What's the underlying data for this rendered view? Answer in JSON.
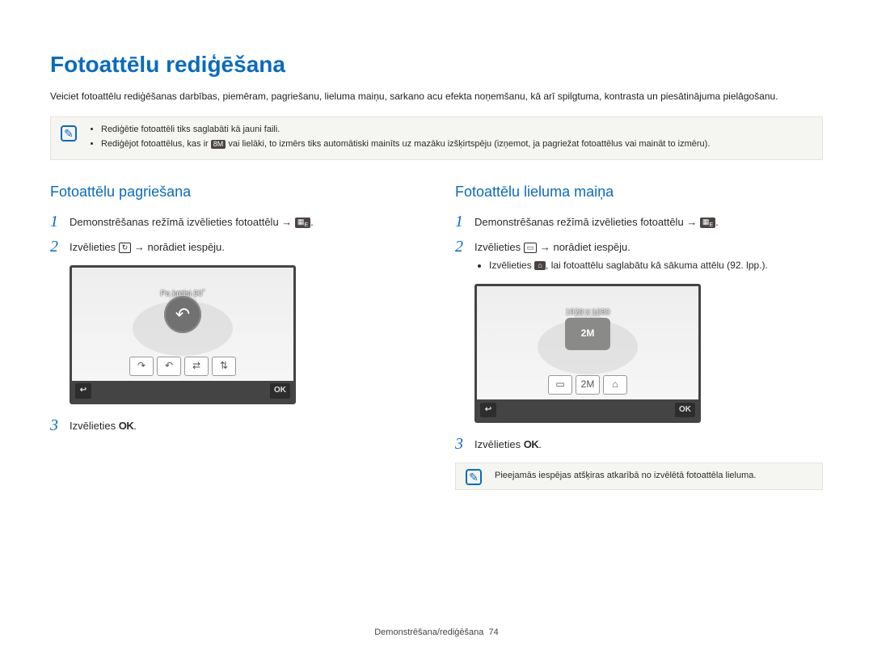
{
  "title": "Fotoattēlu rediģēšana",
  "intro": "Veiciet fotoattēlu rediģēšanas darbības, piemēram, pagriešanu, lieluma maiņu, sarkano acu efekta noņemšanu, kā arī spilgtuma, kontrasta un piesātinājuma pielāgošanu.",
  "note_top": {
    "item1": "Rediģētie fotoattēli tiks saglabāti kā jauni faili.",
    "item2_a": "Rediģējot fotoattēlus, kas ir ",
    "item2_icon": "8M",
    "item2_b": " vai lielāki, to izmērs tiks automātiski mainīts uz mazāku izšķirtspēju (izņemot, ja pagriežat fotoattēlus vai maināt to izmēru)."
  },
  "left": {
    "heading": "Fotoattēlu pagriešana",
    "step1": "Demonstrēšanas režīmā izvēlieties fotoattēlu ",
    "step2_a": "Izvēlieties ",
    "step2_b": " norādiet iespēju.",
    "device_caption": "Pa kreisi 90˚",
    "step3": "Izvēlieties "
  },
  "right": {
    "heading": "Fotoattēlu lieluma maiņa",
    "step1": "Demonstrēšanas režīmā izvēlieties fotoattēlu ",
    "step2_a": "Izvēlieties ",
    "step2_b": " norādiet iespēju.",
    "sub1_a": "Izvēlieties ",
    "sub1_b": ", lai fotoattēlu saglabātu kā sākuma attēlu (92. lpp.).",
    "device_caption": "1920 x 1080",
    "device_big": "2M",
    "step3": "Izvēlieties ",
    "note_bottom": "Pieejamās iespējas atšķiras atkarībā no izvēlētā fotoattēla lieluma."
  },
  "ok_label": "OK",
  "back_glyph": "↩",
  "footer_a": "Demonstrēšana/rediģēšana",
  "footer_page": "74"
}
